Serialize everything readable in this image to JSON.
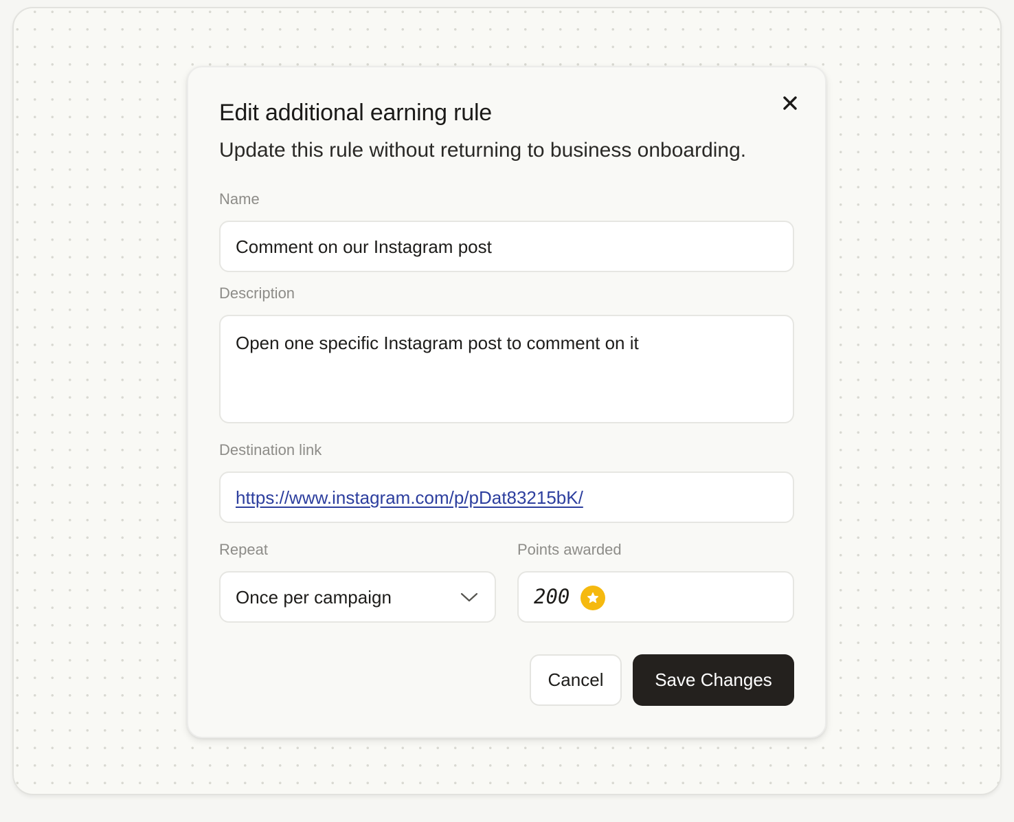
{
  "dialog": {
    "title": "Edit additional earning rule",
    "subtitle": "Update this rule without returning to business onboarding.",
    "close_icon": "close-icon"
  },
  "form": {
    "name": {
      "label": "Name",
      "value": "Comment on our Instagram post"
    },
    "description": {
      "label": "Description",
      "value": "Open one specific Instagram post to comment on it"
    },
    "destination_link": {
      "label": "Destination link",
      "value": "https://www.instagram.com/p/pDat83215bK/"
    },
    "repeat": {
      "label": "Repeat",
      "selected": "Once per campaign",
      "icon": "chevron-down-icon"
    },
    "points": {
      "label": "Points awarded",
      "value": "200",
      "icon": "star-coin-icon"
    }
  },
  "actions": {
    "cancel_label": "Cancel",
    "save_label": "Save Changes"
  },
  "colors": {
    "primary_button": "#24211e",
    "link": "#2c3e9e",
    "coin": "#f5b90f"
  }
}
